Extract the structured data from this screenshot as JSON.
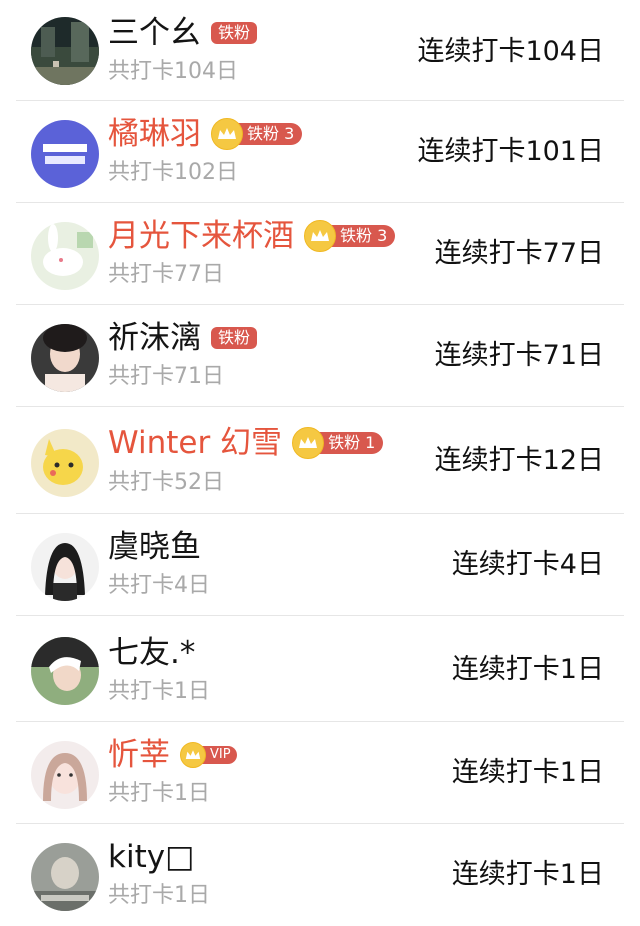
{
  "users": [
    {
      "name": "三个幺",
      "name_color": "normal",
      "badge": {
        "label": "铁粉",
        "crown": false,
        "level": ""
      },
      "total": "共打卡104日",
      "streak": "连续打卡104日",
      "avatar": "dark-forest"
    },
    {
      "name": "橘琳羽",
      "name_color": "highlight",
      "badge": {
        "label": "铁粉",
        "crown": true,
        "level": "3"
      },
      "total": "共打卡102日",
      "streak": "连续打卡101日",
      "avatar": "purple-logo"
    },
    {
      "name": "月光下来杯酒",
      "name_color": "highlight",
      "badge": {
        "label": "铁粉",
        "crown": true,
        "level": "3"
      },
      "total": "共打卡77日",
      "streak": "连续打卡77日",
      "avatar": "white-rabbit"
    },
    {
      "name": "祈沫漓",
      "name_color": "normal",
      "badge": {
        "label": "铁粉",
        "crown": false,
        "level": ""
      },
      "total": "共打卡71日",
      "streak": "连续打卡71日",
      "avatar": "girl-portrait"
    },
    {
      "name": "Winter 幻雪",
      "name_color": "highlight",
      "badge": {
        "label": "铁粉",
        "crown": true,
        "level": "1"
      },
      "total": "共打卡52日",
      "streak": "连续打卡12日",
      "avatar": "yellow-cartoon"
    },
    {
      "name": "虞晓鱼",
      "name_color": "normal",
      "badge": null,
      "total": "共打卡4日",
      "streak": "连续打卡4日",
      "avatar": "anime-girl"
    },
    {
      "name": "七友.*",
      "name_color": "normal",
      "badge": null,
      "total": "共打卡1日",
      "streak": "连续打卡1日",
      "avatar": "green-photo"
    },
    {
      "name": "忻莘",
      "name_color": "highlight",
      "badge": {
        "label": "VIP",
        "crown": true,
        "level": ""
      },
      "total": "共打卡1日",
      "streak": "连续打卡1日",
      "avatar": "light-portrait"
    },
    {
      "name": "kity□",
      "name_color": "normal",
      "badge": null,
      "total": "共打卡1日",
      "streak": "连续打卡1日",
      "avatar": "grey-photo"
    }
  ]
}
